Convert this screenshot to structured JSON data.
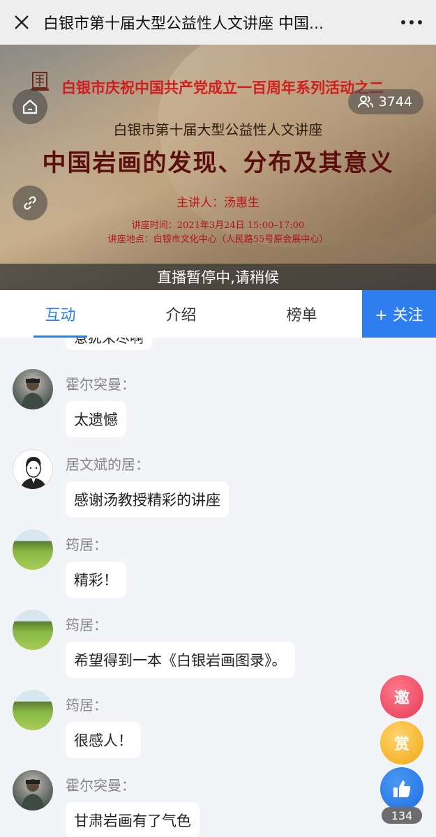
{
  "header": {
    "title": "白银市第十届大型公益性人文讲座 中国..."
  },
  "banner": {
    "headline_red": "白银市庆祝中国共产党成立一百周年系列活动之二",
    "series": "白银市第十届大型公益性人文讲座",
    "main_title": "中国岩画的发现、分布及其意义",
    "speaker": "主讲人：汤惠生",
    "time": "讲座时间：2021年3月24日 15:00–17:00",
    "place": "讲座地点：白银市文化中心（人民路55号原会展中心）",
    "viewer_count": "3744",
    "status": "直播暂停中,请稍候"
  },
  "tabs": {
    "items": [
      "互动",
      "介绍",
      "榜单"
    ],
    "active": "互动",
    "follow_label": "+ 关注"
  },
  "chat": {
    "partial_text": "意犹未尽啊",
    "messages": [
      {
        "user": "霍尔突曼：",
        "text": "太遗憾",
        "avatar": "photographer-photo"
      },
      {
        "user": "居文斌的居：",
        "text": "感谢汤教授精彩的讲座",
        "avatar": "cartoon-man"
      },
      {
        "user": "筠居：",
        "text": "精彩！",
        "avatar": "green-field"
      },
      {
        "user": "筠居：",
        "text": "希望得到一本《白银岩画图录》。",
        "avatar": "green-field"
      },
      {
        "user": "筠居：",
        "text": "很感人！",
        "avatar": "green-field"
      },
      {
        "user": "霍尔突曼：",
        "text": "甘肃岩画有了气色",
        "avatar": "photographer-photo"
      }
    ]
  },
  "actions": {
    "invite_label": "邀",
    "reward_label": "赏",
    "like_count": "134"
  },
  "colors": {
    "accent": "#2e7ef0",
    "banner_red": "#d11d1d",
    "invite": "#e53a55",
    "reward": "#f2a816"
  }
}
